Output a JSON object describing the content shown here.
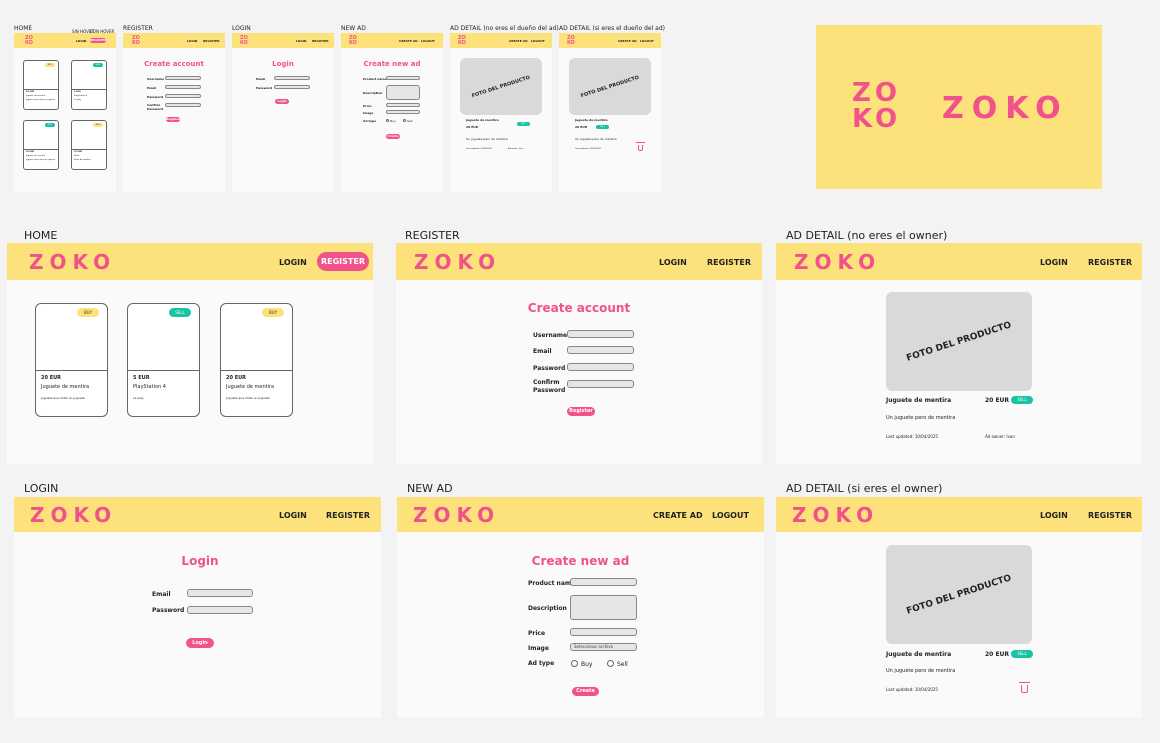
{
  "colors": {
    "pink": "#f2528a",
    "yellow": "#fde27b",
    "teal": "#17c3a2",
    "gray": "#d9d9d9"
  },
  "logo": "ZOKO",
  "logo_stacked": [
    "ZO",
    "KO"
  ],
  "thumbs": {
    "home": "HOME",
    "home_nav": [
      "SIN HOVER",
      "CON HOVER"
    ],
    "register": "REGISTER",
    "login": "LOGIN",
    "new_ad": "NEW AD",
    "detail_not_owner": "AD DETAIL (no eres el dueño del ad)",
    "detail_owner": "AD DETAIL (si eres el dueño del ad)"
  },
  "labels": {
    "home": "HOME",
    "register": "REGISTER",
    "detail_not_owner": "AD DETAIL (no eres el owner)",
    "login": "LOGIN",
    "new_ad": "NEW AD",
    "detail_owner": "AD DETAIL (si eres el owner)"
  },
  "nav": {
    "login": "LOGIN",
    "register": "REGISTER",
    "create_ad": "CREATE AD",
    "logout": "LOGOUT"
  },
  "home": {
    "cards": [
      {
        "badge": "BUY",
        "type": "buy",
        "price": "20 EUR",
        "title": "Juguete de mentira",
        "desc": "Juguete que imita un juguete"
      },
      {
        "badge": "SELL",
        "type": "sell",
        "price": "5 EUR",
        "title": "PlayStation 4",
        "desc": "La play"
      },
      {
        "badge": "BUY",
        "type": "buy",
        "price": "20 EUR",
        "title": "Juguete de mentira",
        "desc": "Juguete que imita un juguete"
      }
    ],
    "small_cards": [
      {
        "badge": "BUY",
        "type": "buy",
        "price": "20 EUR",
        "title": "Juguete de mentira",
        "desc": "Juguete que imita un juguete"
      },
      {
        "badge": "SELL",
        "type": "sell",
        "price": "5 EUR",
        "title": "PlayStation 4",
        "desc": "La play"
      },
      {
        "badge": "SELL",
        "type": "sell",
        "price": "20 EUR",
        "title": "Juguete de mentira",
        "desc": "Juguete que imita un juguete"
      },
      {
        "badge": "BUY",
        "type": "buy",
        "price": "15 EUR",
        "title": "Mesa",
        "desc": "Mesa de madera"
      }
    ]
  },
  "register": {
    "title": "Create account",
    "fields": [
      "Username",
      "Email",
      "Password",
      "Confirm Password"
    ],
    "button": "Register"
  },
  "login": {
    "title": "Login",
    "fields": [
      "Email",
      "Password"
    ],
    "button": "Login"
  },
  "new_ad": {
    "title": "Create new ad",
    "fields": {
      "product_name": "Product name",
      "description": "Description",
      "price": "Price",
      "image": "Image",
      "ad_type": "Ad type"
    },
    "image_value": "Seleccionar archivo",
    "options": [
      "Buy",
      "Sell"
    ],
    "button": "Create"
  },
  "detail": {
    "photo": "FOTO DEL PRODUCTO",
    "title": "Juguete de mentira",
    "price": "20 EUR",
    "badge": "SELL",
    "desc": "Un juguete pero de mentira",
    "updated": "Last updated: 10/04/2025",
    "owner": "Ad owner: Ivan"
  }
}
